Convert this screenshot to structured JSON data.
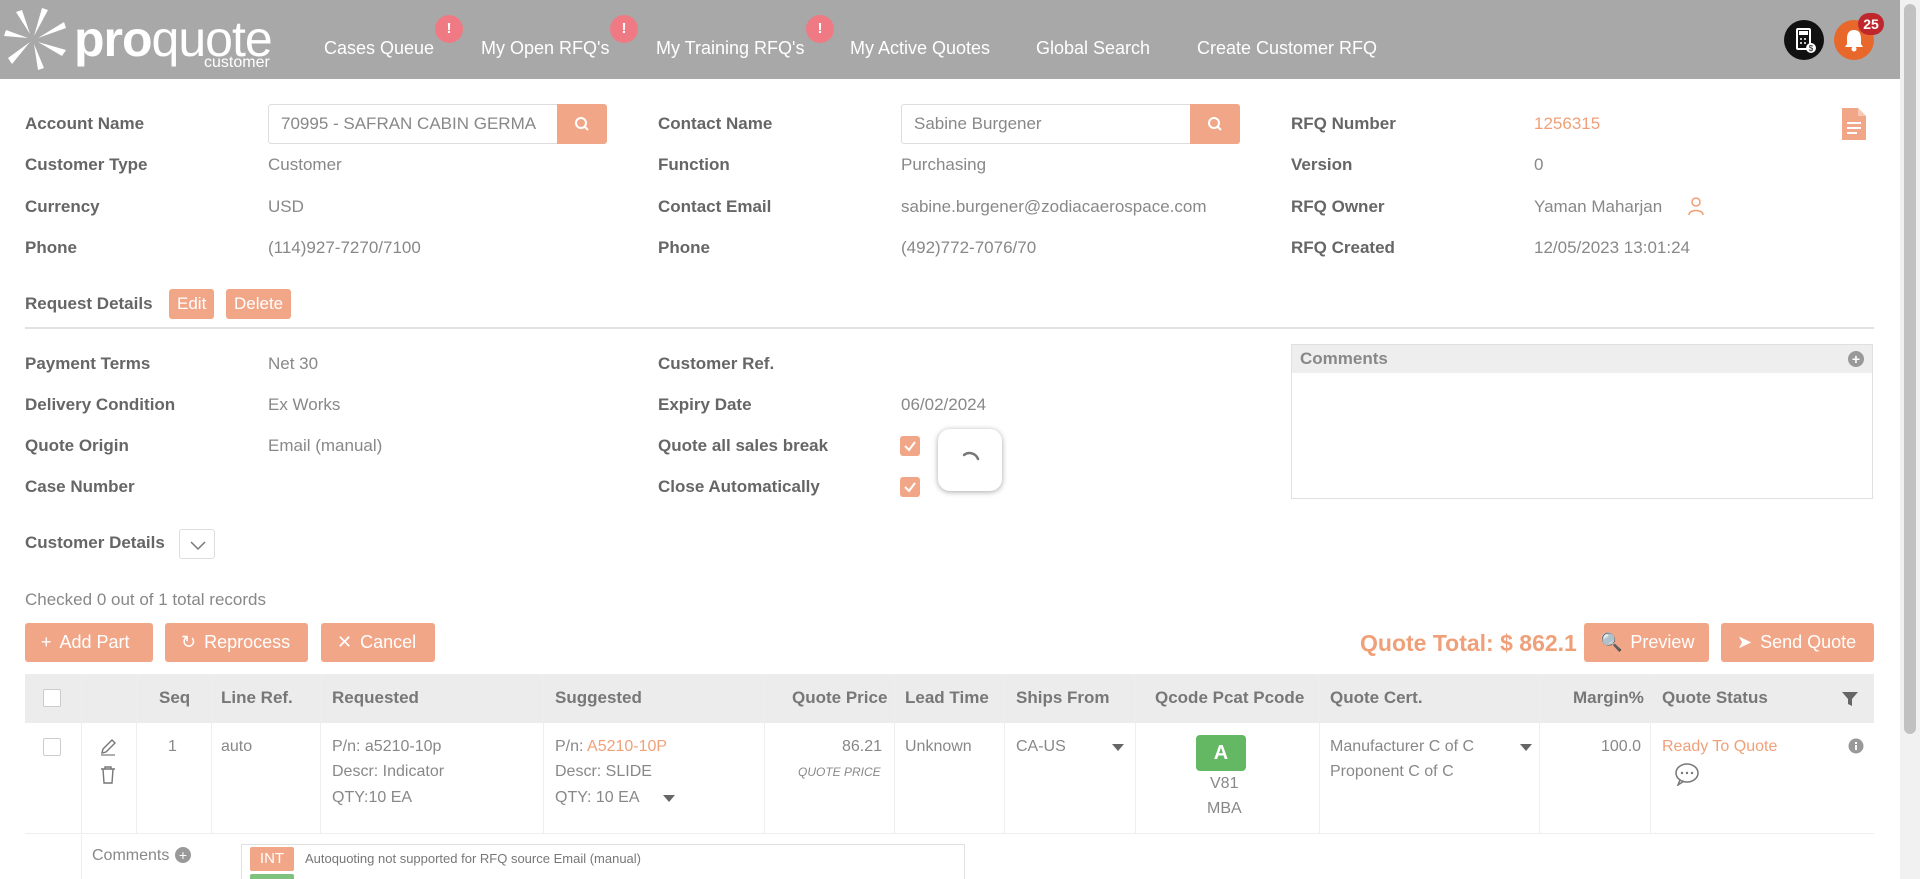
{
  "app": {
    "logo_text_bold": "pro",
    "logo_text_light": "quote",
    "logo_sub": "customer"
  },
  "nav": {
    "items": [
      "Cases Queue",
      "My Open RFQ's",
      "My Training RFQ's",
      "My Active Quotes",
      "Global Search",
      "Create Customer RFQ"
    ],
    "alert_glyph": "!",
    "notification_count": "25"
  },
  "account": {
    "account_name_label": "Account Name",
    "account_name_value": "70995 - SAFRAN CABIN GERMA",
    "customer_type_label": "Customer Type",
    "customer_type_value": "Customer",
    "currency_label": "Currency",
    "currency_value": "USD",
    "phone_label": "Phone",
    "phone_value": "(114)927-7270/7100"
  },
  "contact": {
    "contact_name_label": "Contact Name",
    "contact_name_value": "Sabine  Burgener",
    "function_label": "Function",
    "function_value": "Purchasing",
    "email_label": "Contact Email",
    "email_value": "sabine.burgener@zodiacaerospace.com",
    "phone_label": "Phone",
    "phone_value": "(492)772-7076/70"
  },
  "rfq": {
    "number_label": "RFQ Number",
    "number_value": "1256315",
    "version_label": "Version",
    "version_value": "0",
    "owner_label": "RFQ Owner",
    "owner_value": "Yaman Maharjan",
    "created_label": "RFQ Created",
    "created_value": "12/05/2023 13:01:24"
  },
  "request": {
    "title": "Request Details",
    "edit_label": "Edit",
    "delete_label": "Delete",
    "payment_terms_label": "Payment Terms",
    "payment_terms_value": "Net 30",
    "delivery_label": "Delivery Condition",
    "delivery_value": "Ex Works",
    "origin_label": "Quote Origin",
    "origin_value": "Email (manual)",
    "case_label": "Case Number",
    "case_value": "",
    "customer_ref_label": "Customer Ref.",
    "customer_ref_value": "",
    "expiry_label": "Expiry Date",
    "expiry_value": "06/02/2024",
    "sales_break_label": "Quote all sales break",
    "sales_break_checked": true,
    "close_auto_label": "Close Automatically",
    "close_auto_checked": true,
    "comments_title": "Comments"
  },
  "customer_details": {
    "title": "Customer Details"
  },
  "records": {
    "summary": "Checked 0 out of 1 total records"
  },
  "actions": {
    "add_part": "Add Part",
    "reprocess": "Reprocess",
    "cancel": "Cancel",
    "quote_total": "Quote Total: $ 862.1",
    "preview": "Preview",
    "send_quote": "Send Quote"
  },
  "table": {
    "headers": {
      "seq": "Seq",
      "line_ref": "Line Ref.",
      "requested": "Requested",
      "suggested": "Suggested",
      "quote_price": "Quote Price",
      "lead_time": "Lead Time",
      "ships_from": "Ships From",
      "qcode": "Qcode Pcat Pcode",
      "quote_cert": "Quote Cert.",
      "margin": "Margin%",
      "quote_status": "Quote Status"
    },
    "rows": [
      {
        "seq": "1",
        "line_ref": "auto",
        "req_pn": "P/n: a5210-10p",
        "req_descr": "Descr: Indicator",
        "req_qty": "QTY:10 EA",
        "sug_pn_prefix": "P/n: ",
        "sug_pn": "A5210-10P",
        "sug_descr": "Descr: SLIDE",
        "sug_qty": "QTY:  10  EA",
        "quote_price": "86.21",
        "quote_price_note": "QUOTE PRICE",
        "lead_time": "Unknown",
        "ships_from": "CA-US",
        "qcode": "A",
        "pcat": "V81",
        "pcode": "MBA",
        "cert_1": "Manufacturer C of C",
        "cert_2": "Proponent C of C",
        "margin": "100.0",
        "status": "Ready To Quote"
      }
    ],
    "sub_comments_label": "Comments",
    "sub_int_badge": "INT",
    "sub_comment_text": "Autoquoting not supported for RFQ source Email (manual)"
  },
  "colors": {
    "header_bg": "#a8a8a8",
    "accent": "#f2a688",
    "accent_text": "#f0a079",
    "qcode_green": "#64b864",
    "alert_pink": "#f07a84"
  }
}
